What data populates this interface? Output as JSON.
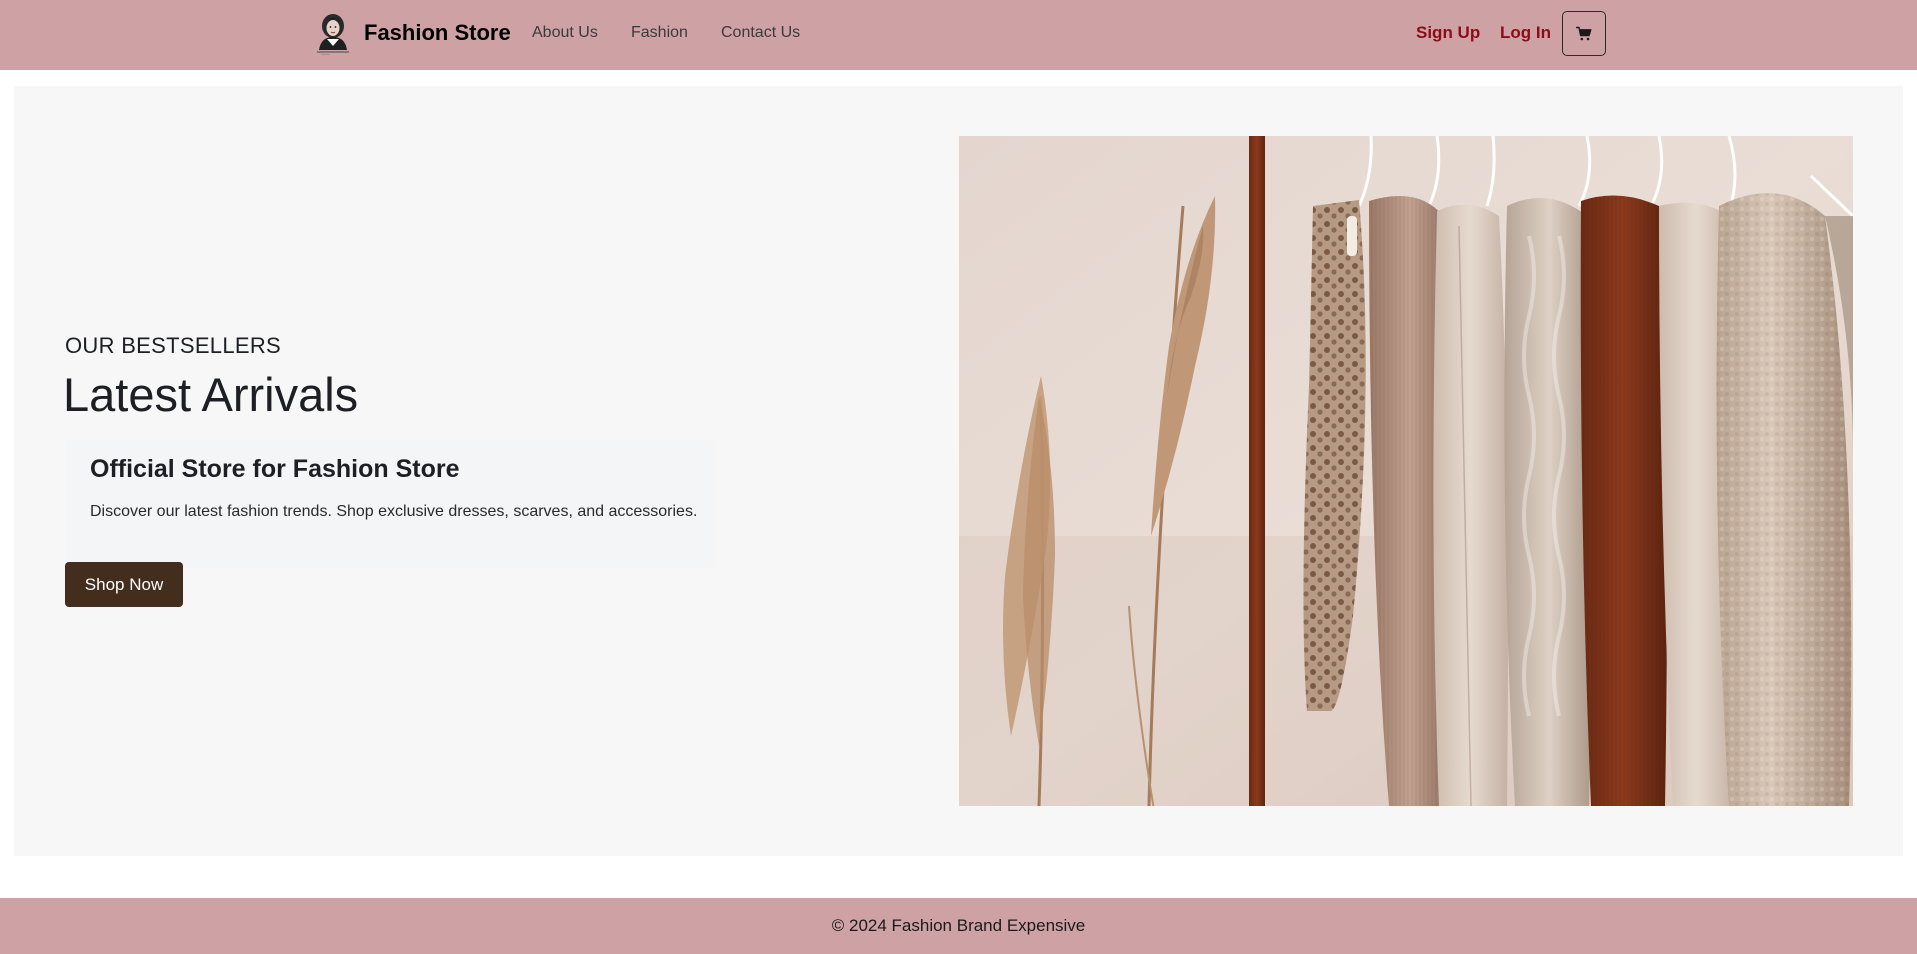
{
  "navbar": {
    "brand_name": "Fashion Store",
    "logo_icon": "woman-portrait-icon",
    "links": [
      {
        "label": "About Us"
      },
      {
        "label": "Fashion"
      },
      {
        "label": "Contact Us"
      }
    ],
    "signup_label": "Sign Up",
    "login_label": "Log In",
    "cart_icon": "shopping-cart-icon"
  },
  "hero": {
    "kicker": "OUR BESTSELLERS",
    "title": "Latest Arrivals",
    "subtitle": "Official Store for Fashion Store",
    "description": "Discover our latest fashion trends. Shop exclusive dresses, scarves, and accessories.",
    "button_label": "Shop Now",
    "image_subject": "clothes-on-rack-photo"
  },
  "footer": {
    "text": "© 2024 Fashion Brand Expensive"
  },
  "colors": {
    "navbar_bg": "#cea2a4",
    "auth_link": "#8b0c17",
    "button_bg": "#432d1d",
    "hero_bg": "#f7f7f7"
  }
}
